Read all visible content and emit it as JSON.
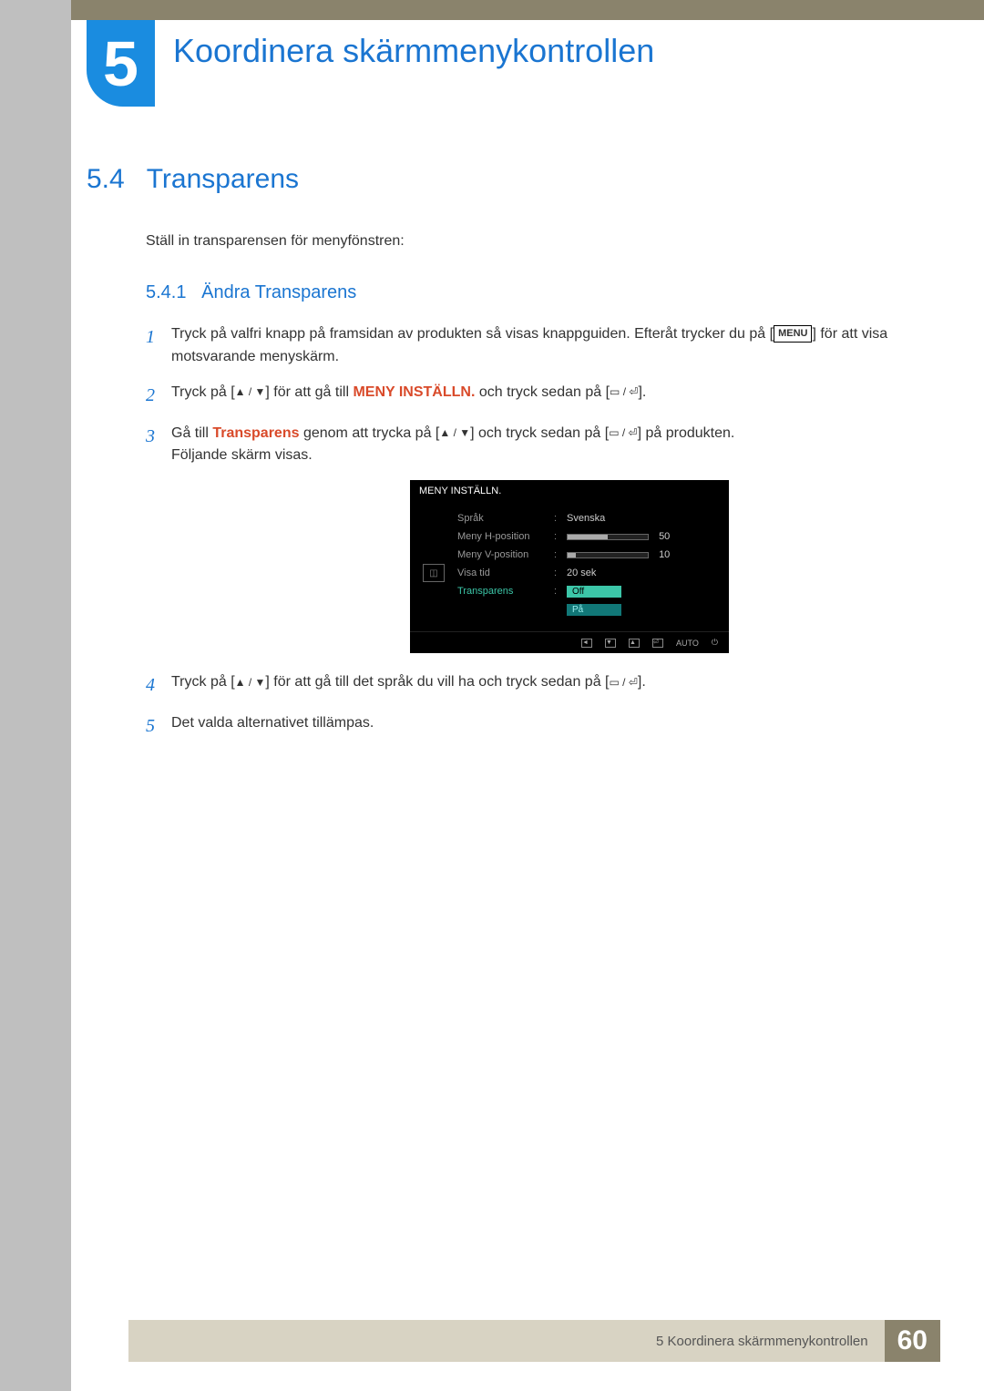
{
  "chapter": {
    "number": "5",
    "title": "Koordinera skärmmenykontrollen"
  },
  "section": {
    "number": "5.4",
    "title": "Transparens"
  },
  "intro": "Ställ in transparensen för menyfönstren:",
  "subsection": {
    "number": "5.4.1",
    "title": "Ändra Transparens"
  },
  "steps": {
    "s1": {
      "num": "1",
      "a": "Tryck på valfri knapp på framsidan av produkten så visas knappguiden. Efteråt trycker du på [",
      "menu": "MENU",
      "b": "] för att visa motsvarande menyskärm."
    },
    "s2": {
      "num": "2",
      "a": "Tryck på [",
      "b": "] för att gå till ",
      "menylabel": "MENY INSTÄLLN.",
      "c": " och tryck sedan på [",
      "d": "]."
    },
    "s3": {
      "num": "3",
      "a": "Gå till ",
      "trans": "Transparens",
      "b": " genom att trycka på [",
      "c": "] och tryck sedan på [",
      "d": "] på produkten.",
      "e": "Följande skärm visas."
    },
    "s4": {
      "num": "4",
      "a": "Tryck på [",
      "b": "] för att gå till det språk du vill ha och tryck sedan på [",
      "c": "]."
    },
    "s5": {
      "num": "5",
      "a": "Det valda alternativet tillämpas."
    }
  },
  "osd": {
    "title": "MENY INSTÄLLN.",
    "rows": {
      "sprak": {
        "label": "Språk",
        "value": "Svenska"
      },
      "hpos": {
        "label": "Meny H-position",
        "value": "50",
        "fill": 50
      },
      "vpos": {
        "label": "Meny V-position",
        "value": "10",
        "fill": 10
      },
      "visa": {
        "label": "Visa tid",
        "value": "20 sek"
      },
      "trans": {
        "label": "Transparens",
        "opt1": "Off",
        "opt2": "På"
      }
    },
    "foot": {
      "auto": "AUTO"
    }
  },
  "footer": {
    "text": "5 Koordinera skärmmenykontrollen",
    "page": "60"
  },
  "icons": {
    "updown": "▲ / ▼",
    "enter": "▭ / ⏎"
  }
}
